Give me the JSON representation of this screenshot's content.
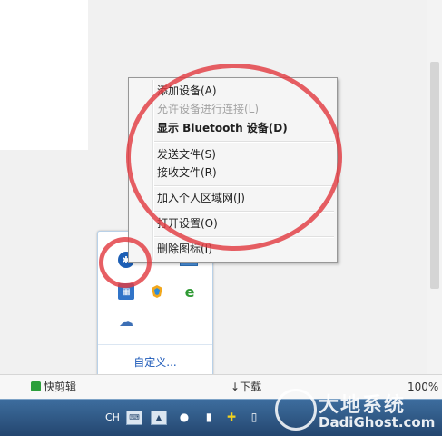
{
  "context_menu": {
    "items": [
      {
        "label": "添加设备(A)",
        "state": "normal"
      },
      {
        "label": "允许设备进行连接(L)",
        "state": "disabled"
      },
      {
        "label": "显示 Bluetooth 设备(D)",
        "state": "bold"
      },
      {
        "label": "发送文件(S)",
        "state": "normal"
      },
      {
        "label": "接收文件(R)",
        "state": "normal"
      },
      {
        "label": "加入个人区域网(J)",
        "state": "normal"
      },
      {
        "label": "打开设置(O)",
        "state": "normal"
      },
      {
        "label": "删除图标(I)",
        "state": "normal"
      }
    ]
  },
  "tray_flyout": {
    "customize_label": "自定义..."
  },
  "status_bar": {
    "items": [
      {
        "label": "快剪辑"
      },
      {
        "label": "下载"
      },
      {
        "label": "100%"
      }
    ]
  },
  "taskbar": {
    "language": "CH"
  },
  "watermark": {
    "title": "大地系统",
    "url": "DadiGhost.com"
  },
  "colors": {
    "annotation_ring": "#e23c42",
    "taskbar": "#2e5580",
    "link": "#1b58b8"
  }
}
